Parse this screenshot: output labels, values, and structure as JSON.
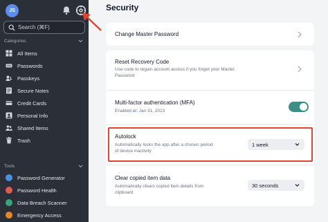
{
  "user": {
    "initials": "JS"
  },
  "search": {
    "label": "Search (⌘F)"
  },
  "categories_header": "Categories",
  "categories": [
    {
      "label": "All Items",
      "icon": "all-items-icon"
    },
    {
      "label": "Passwords",
      "icon": "passwords-icon"
    },
    {
      "label": "Passkeys",
      "icon": "passkeys-icon"
    },
    {
      "label": "Secure Notes",
      "icon": "secure-notes-icon"
    },
    {
      "label": "Credit Cards",
      "icon": "credit-cards-icon"
    },
    {
      "label": "Personal Info",
      "icon": "personal-info-icon"
    },
    {
      "label": "Shared Items",
      "icon": "shared-items-icon"
    },
    {
      "label": "Trash",
      "icon": "trash-icon"
    }
  ],
  "tools_header": "Tools",
  "tools": [
    {
      "label": "Password Generator",
      "color": "#4a90e2"
    },
    {
      "label": "Password Health",
      "color": "#e05a4f"
    },
    {
      "label": "Data Breach Scanner",
      "color": "#3aa57a"
    },
    {
      "label": "Emergency Access",
      "color": "#e8862a"
    }
  ],
  "page": {
    "title": "Security",
    "change_master_password": "Change Master Password",
    "reset_recovery": {
      "title": "Reset Recovery Code",
      "sub1": "Use code to regain account access if you forget your Master",
      "sub2": "Password"
    },
    "mfa": {
      "title": "Multi-factor authentication (MFA)",
      "sub": "Enabled at: Jan 31, 2023",
      "enabled": true
    },
    "autolock": {
      "title": "Autolock",
      "sub1": "Automatically locks the app after a chosen period",
      "sub2": "of device inactivity",
      "value": "1 week"
    },
    "clear_clipboard": {
      "title": "Clear copied item data",
      "sub1": "Automatically clears copied item details from",
      "sub2": "clipboard",
      "value": "30 seconds"
    }
  },
  "colors": {
    "accent": "#3b8f84",
    "highlight": "#e0432f",
    "sidebar": "#2b2f38"
  }
}
